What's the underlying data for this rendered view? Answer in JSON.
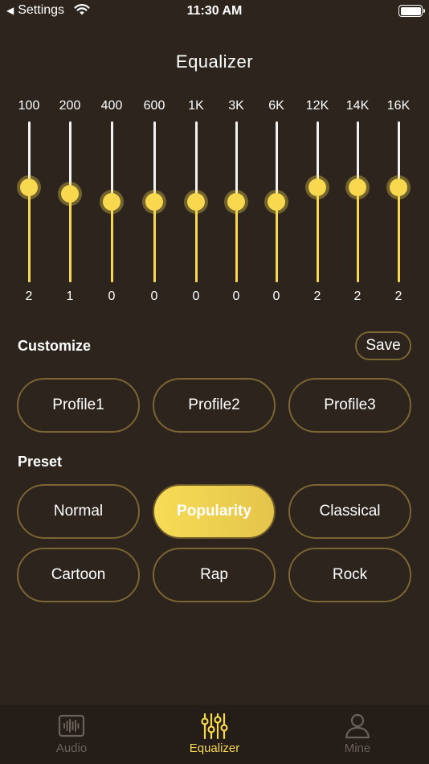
{
  "status_bar": {
    "back_label": "Settings",
    "time": "11:30 AM"
  },
  "title": "Equalizer",
  "bands": [
    {
      "freq": "100",
      "value": "2",
      "level": 0.59
    },
    {
      "freq": "200",
      "value": "1",
      "level": 0.55
    },
    {
      "freq": "400",
      "value": "0",
      "level": 0.5
    },
    {
      "freq": "600",
      "value": "0",
      "level": 0.5
    },
    {
      "freq": "1K",
      "value": "0",
      "level": 0.5
    },
    {
      "freq": "3K",
      "value": "0",
      "level": 0.5
    },
    {
      "freq": "6K",
      "value": "0",
      "level": 0.5
    },
    {
      "freq": "12K",
      "value": "2",
      "level": 0.59
    },
    {
      "freq": "14K",
      "value": "2",
      "level": 0.59
    },
    {
      "freq": "16K",
      "value": "2",
      "level": 0.59
    }
  ],
  "customize": {
    "label": "Customize",
    "save_label": "Save",
    "profiles": [
      "Profile1",
      "Profile2",
      "Profile3"
    ]
  },
  "preset": {
    "label": "Preset",
    "items": [
      "Normal",
      "Popularity",
      "Classical",
      "Cartoon",
      "Rap",
      "Rock"
    ],
    "selected": "Popularity"
  },
  "tab_bar": {
    "tabs": [
      {
        "label": "Audio",
        "icon": "waveform-icon"
      },
      {
        "label": "Equalizer",
        "icon": "sliders-icon"
      },
      {
        "label": "Mine",
        "icon": "person-icon"
      }
    ],
    "selected": "Equalizer"
  },
  "colors": {
    "background": "#2c241d",
    "accent": "#f7d84e",
    "pill_border": "#7a6533",
    "tab_bar_bg": "#241d18",
    "inactive_tab": "#6a625a"
  }
}
